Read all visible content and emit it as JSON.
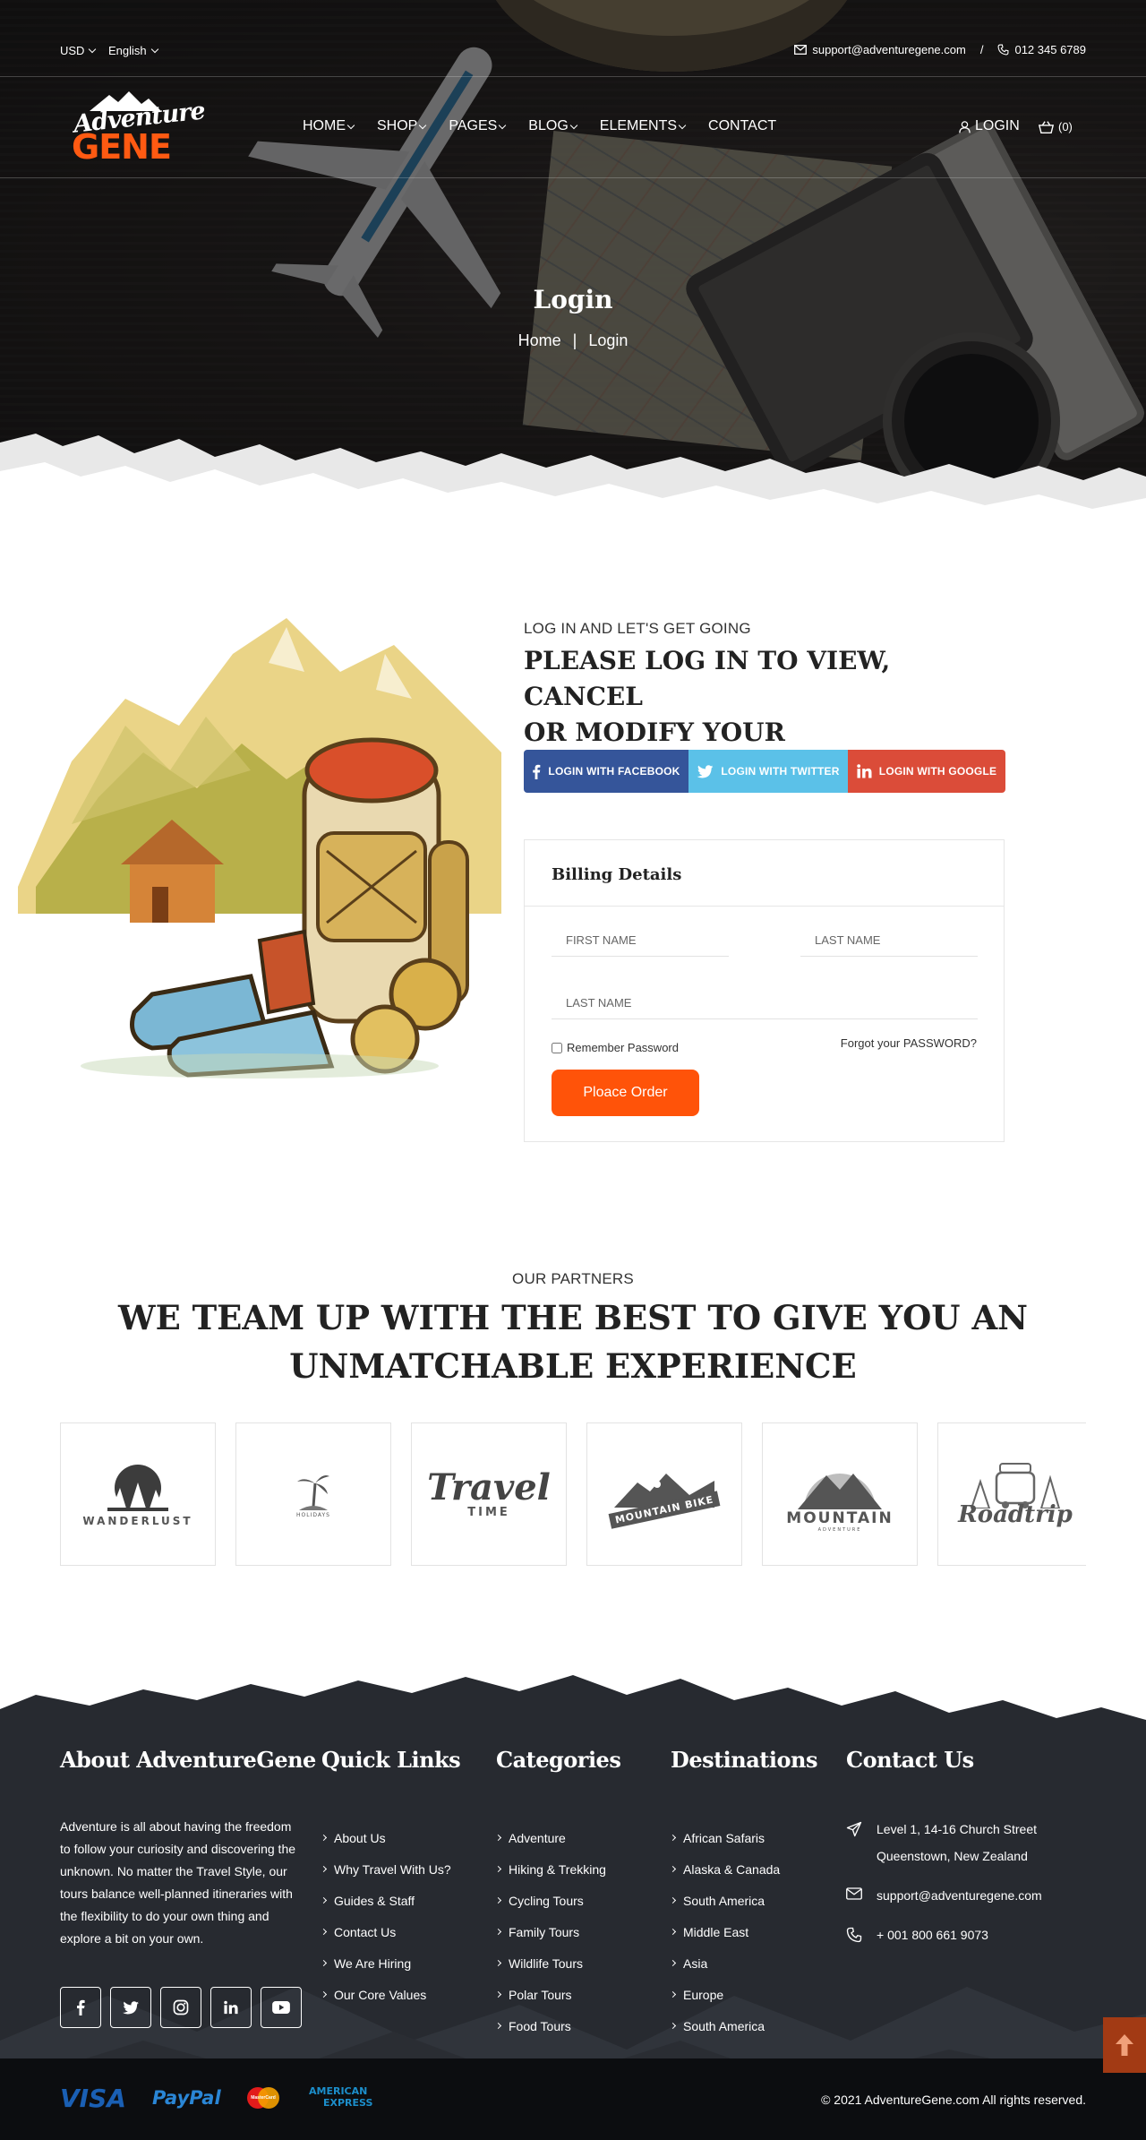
{
  "topbar": {
    "currency": "USD",
    "language": "English",
    "email": "support@adventuregene.com",
    "separator": "/",
    "phone": "012 345 6789"
  },
  "brand": {
    "logo_line1": "Adventure",
    "logo_line2": "GENE"
  },
  "nav": {
    "items": [
      "HOME",
      "SHOP",
      "PAGES",
      "BLOG",
      "ELEMENTS",
      "CONTACT"
    ],
    "login": "LOGIN",
    "cart_count": "(0)"
  },
  "hero": {
    "title": "Login",
    "breadcrumb_home": "Home",
    "breadcrumb_sep": "|",
    "breadcrumb_current": "Login"
  },
  "login": {
    "kicker": "LOG IN AND LET'S GET GOING",
    "heading_line1": "PLEASE LOG IN TO VIEW, CANCEL",
    "heading_line2": "OR MODIFY YOUR RESERVATIONS.",
    "facebook": "LOGIN WITH FACEBOOK",
    "twitter": "LOGIN WITH TWITTER",
    "google": "LOGIN WITH GOOGLE"
  },
  "billing": {
    "title": "Billing Details",
    "first_name_placeholder": "FIRST NAME",
    "last_name_placeholder": "LAST NAME",
    "last_name2_placeholder": "LAST NAME",
    "remember": "Remember Password",
    "forgot_text": "Forgot your",
    "forgot_link": "PASSWORD?",
    "submit": "Ploace Order"
  },
  "partners": {
    "kicker": "OUR PARTNERS",
    "title_line1": "WE TEAM UP WITH THE BEST TO GIVE YOU AN",
    "title_line2": "UNMATCHABLE EXPERIENCE",
    "logos": [
      "WANDERLUST",
      "HOLIDAYS",
      "Travel",
      "TIME",
      "MOUNTAIN BIKE",
      "MOUNTAIN",
      "ADVENTURE",
      "Roadtrip"
    ]
  },
  "footer": {
    "about_title": "About AdventureGene",
    "about_text": "Adventure is all about having the freedom to follow your curiosity and discovering the unknown. No matter the Travel Style, our tours balance well-planned itineraries with the flexibility to do your own thing and explore a bit on your own.",
    "quick_title": "Quick Links",
    "quick_links": [
      "About Us",
      "Why Travel With Us?",
      "Guides & Staff",
      "Contact Us",
      "We Are Hiring",
      "Our Core Values"
    ],
    "cat_title": "Categories",
    "categories": [
      "Adventure",
      "Hiking & Trekking",
      "Cycling Tours",
      "Family Tours",
      "Wildlife Tours",
      "Polar Tours",
      "Food Tours"
    ],
    "dest_title": "Destinations",
    "destinations": [
      "African Safaris",
      "Alaska & Canada",
      "South America",
      "Middle East",
      "Asia",
      "Europe",
      "South America"
    ],
    "contact_title": "Contact Us",
    "address_line1": "Level 1, 14-16 Church Street",
    "address_line2": "Queenstown, New Zealand",
    "email": "support@adventuregene.com",
    "phone": "+ 001 800 661 9073",
    "payments": [
      "VISA",
      "PayPal",
      "MasterCard",
      "AMERICAN",
      "EXPRESS"
    ],
    "copyright": "© 2021 AdventureGene.com All rights reserved."
  },
  "colors": {
    "accent": "#ff5309",
    "facebook": "#35559a",
    "twitter": "#5bc1e8",
    "google": "#db4c39",
    "footer": "#272a30"
  }
}
